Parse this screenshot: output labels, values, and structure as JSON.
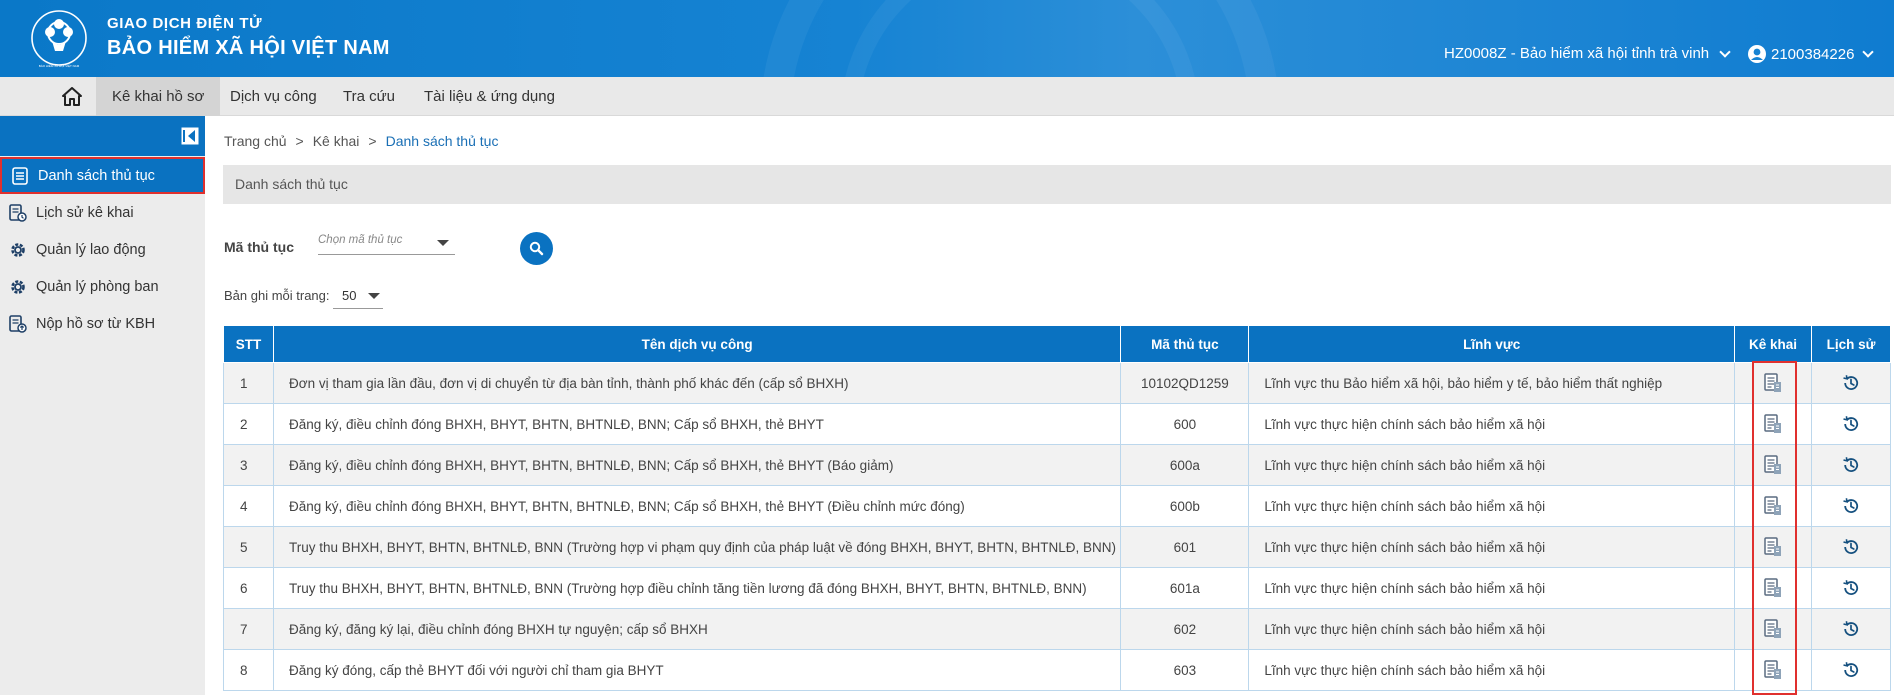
{
  "brand": {
    "top": "GIAO DỊCH ĐIỆN TỬ",
    "main": "BẢO HIỂM XÃ HỘI VIỆT NAM",
    "logo_caption": "BẢO HIỂM XÃ HỘI VIỆT NAM"
  },
  "header": {
    "unit": "HZ0008Z - Bảo hiểm xã hội tỉnh trà vinh",
    "user": "2100384226"
  },
  "nav": {
    "items": [
      {
        "label": "Kê khai hồ sơ",
        "active": true
      },
      {
        "label": "Dịch vụ công",
        "active": false
      },
      {
        "label": "Tra cứu",
        "active": false
      },
      {
        "label": "Tài liệu & ứng dụng",
        "active": false
      }
    ]
  },
  "sidebar": {
    "items": [
      {
        "label": "Danh sách thủ tục",
        "icon": "document-list-icon",
        "active": true
      },
      {
        "label": "Lịch sử kê khai",
        "icon": "history-document-icon",
        "active": false
      },
      {
        "label": "Quản lý lao động",
        "icon": "gear-icon",
        "active": false
      },
      {
        "label": "Quản lý phòng ban",
        "icon": "gear-icon",
        "active": false
      },
      {
        "label": "Nộp hồ sơ từ KBH",
        "icon": "upload-document-icon",
        "active": false
      }
    ]
  },
  "breadcrumb": {
    "home": "Trang chủ",
    "sep": ">",
    "section": "Kê khai",
    "current": "Danh sách thủ tục"
  },
  "section_title": "Danh sách thủ tục",
  "filter": {
    "label": "Mã thủ tục",
    "placeholder": "Chọn mã thủ tục"
  },
  "paging": {
    "label": "Bản ghi mỗi trang:",
    "value": "50"
  },
  "table": {
    "columns": [
      "STT",
      "Tên dịch vụ công",
      "Mã thủ tục",
      "Lĩnh vực",
      "Kê khai",
      "Lịch sử"
    ],
    "rows": [
      {
        "stt": "1",
        "name": "Đơn vị tham gia lần đầu, đơn vị di chuyển từ địa bàn tỉnh, thành phố khác đến (cấp sổ BHXH)",
        "code": "10102QD1259",
        "field": "Lĩnh vực thu Bảo hiểm xã hội, bảo hiểm y tế, bảo hiểm thất nghiệp"
      },
      {
        "stt": "2",
        "name": "Đăng ký, điều chỉnh đóng BHXH, BHYT, BHTN, BHTNLĐ, BNN; Cấp sổ BHXH, thẻ BHYT",
        "code": "600",
        "field": "Lĩnh vực thực hiện chính sách bảo hiểm xã hội"
      },
      {
        "stt": "3",
        "name": "Đăng ký, điều chỉnh đóng BHXH, BHYT, BHTN, BHTNLĐ, BNN; Cấp sổ BHXH, thẻ BHYT (Báo giảm)",
        "code": "600a",
        "field": "Lĩnh vực thực hiện chính sách bảo hiểm xã hội"
      },
      {
        "stt": "4",
        "name": "Đăng ký, điều chỉnh đóng BHXH, BHYT, BHTN, BHTNLĐ, BNN; Cấp sổ BHXH, thẻ BHYT (Điều chỉnh mức đóng)",
        "code": "600b",
        "field": "Lĩnh vực thực hiện chính sách bảo hiểm xã hội"
      },
      {
        "stt": "5",
        "name": "Truy thu BHXH, BHYT, BHTN, BHTNLĐ, BNN (Trường hợp vi phạm quy định của pháp luật về đóng BHXH, BHYT, BHTN, BHTNLĐ, BNN)",
        "code": "601",
        "field": "Lĩnh vực thực hiện chính sách bảo hiểm xã hội"
      },
      {
        "stt": "6",
        "name": "Truy thu BHXH, BHYT, BHTN, BHTNLĐ, BNN (Trường hợp điều chỉnh tăng tiền lương đã đóng BHXH, BHYT, BHTN, BHTNLĐ, BNN)",
        "code": "601a",
        "field": "Lĩnh vực thực hiện chính sách bảo hiểm xã hội"
      },
      {
        "stt": "7",
        "name": "Đăng ký, đăng ký lại, điều chỉnh đóng BHXH tự nguyện; cấp sổ BHXH",
        "code": "602",
        "field": "Lĩnh vực thực hiện chính sách bảo hiểm xã hội"
      },
      {
        "stt": "8",
        "name": "Đăng ký đóng, cấp thẻ BHYT đối với người chỉ tham gia BHYT",
        "code": "603",
        "field": "Lĩnh vực thực hiện chính sách bảo hiểm xã hội"
      }
    ]
  },
  "colors": {
    "primary": "#0a72c1",
    "highlight": "#e0302e"
  }
}
